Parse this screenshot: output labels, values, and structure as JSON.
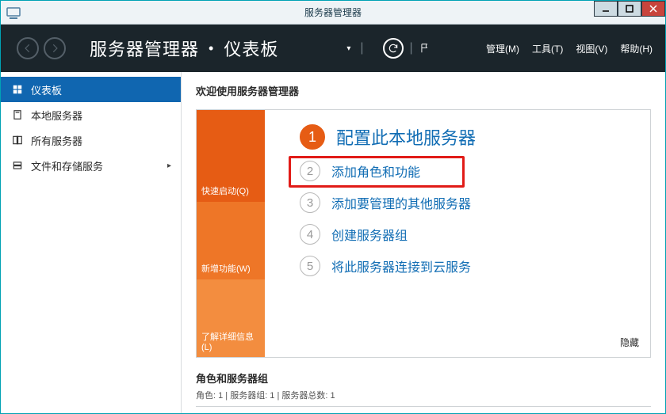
{
  "titlebar": {
    "title": "服务器管理器"
  },
  "header": {
    "crumb_root": "服务器管理器",
    "crumb_current": "仪表板",
    "menu": {
      "manage": "管理(M)",
      "tools": "工具(T)",
      "view": "视图(V)",
      "help": "帮助(H)"
    }
  },
  "sidebar": {
    "items": [
      {
        "label": "仪表板",
        "icon": "dashboard"
      },
      {
        "label": "本地服务器",
        "icon": "server"
      },
      {
        "label": "所有服务器",
        "icon": "servers"
      },
      {
        "label": "文件和存储服务",
        "icon": "storage"
      }
    ]
  },
  "main": {
    "welcome_title": "欢迎使用服务器管理器",
    "orange": {
      "quick_start": "快速启动(Q)",
      "whats_new": "新增功能(W)",
      "learn_more": "了解详细信息(L)"
    },
    "steps": [
      {
        "num": "1",
        "label": "配置此本地服务器",
        "primary": true
      },
      {
        "num": "2",
        "label": "添加角色和功能",
        "highlight": true
      },
      {
        "num": "3",
        "label": "添加要管理的其他服务器"
      },
      {
        "num": "4",
        "label": "创建服务器组"
      },
      {
        "num": "5",
        "label": "将此服务器连接到云服务"
      }
    ],
    "hide_label": "隐藏",
    "roles": {
      "title": "角色和服务器组",
      "subtitle": "角色: 1 | 服务器组: 1 | 服务器总数: 1"
    }
  }
}
